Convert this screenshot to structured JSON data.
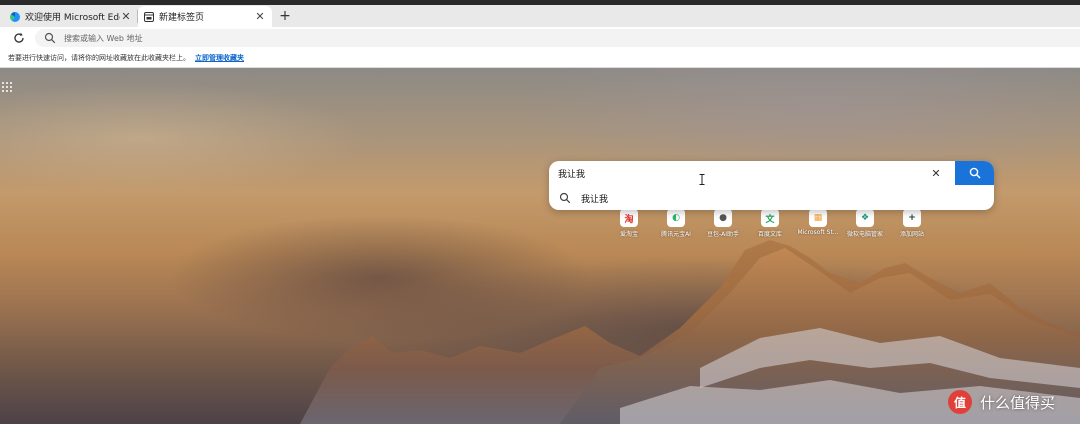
{
  "tabs": [
    {
      "title": "欢迎使用 Microsoft Edge",
      "favicon": "edge-icon"
    },
    {
      "title": "新建标签页",
      "favicon": "newtab-page-icon"
    }
  ],
  "address_bar": {
    "placeholder": "搜索或输入 Web 地址",
    "value": ""
  },
  "favorites_bar": {
    "message": "若要进行快速访问，请将你的网址收藏放在此收藏夹栏上。",
    "link": "立即管理收藏夹"
  },
  "search": {
    "query": "我让我",
    "suggestions": [
      "我让我"
    ]
  },
  "quick_links": [
    {
      "label": "爱淘宝",
      "icon": "taobao-icon",
      "glyph": "淘",
      "color": "#e3372e"
    },
    {
      "label": "腾讯元宝AI",
      "icon": "yuanbao-icon",
      "glyph": "◐",
      "color": "#29b56a"
    },
    {
      "label": "豆包-AI助手",
      "icon": "doubao-avatar-icon",
      "glyph": "●",
      "color": "#555555"
    },
    {
      "label": "百度文库",
      "icon": "baidu-wenku-icon",
      "glyph": "文",
      "color": "#20a35a"
    },
    {
      "label": "Microsoft St...",
      "icon": "microsoft-store-icon",
      "glyph": "▦",
      "color": "#f2a43a"
    },
    {
      "label": "微软电脑管家",
      "icon": "pc-manager-icon",
      "glyph": "❖",
      "color": "#1a9a7a"
    },
    {
      "label": "添加网站",
      "icon": "add-site-icon",
      "glyph": "+",
      "color": "#333333"
    }
  ],
  "watermark": {
    "badge": "值",
    "text": "什么值得买"
  },
  "colors": {
    "accent": "#1a73d9",
    "link": "#0a64c9"
  }
}
